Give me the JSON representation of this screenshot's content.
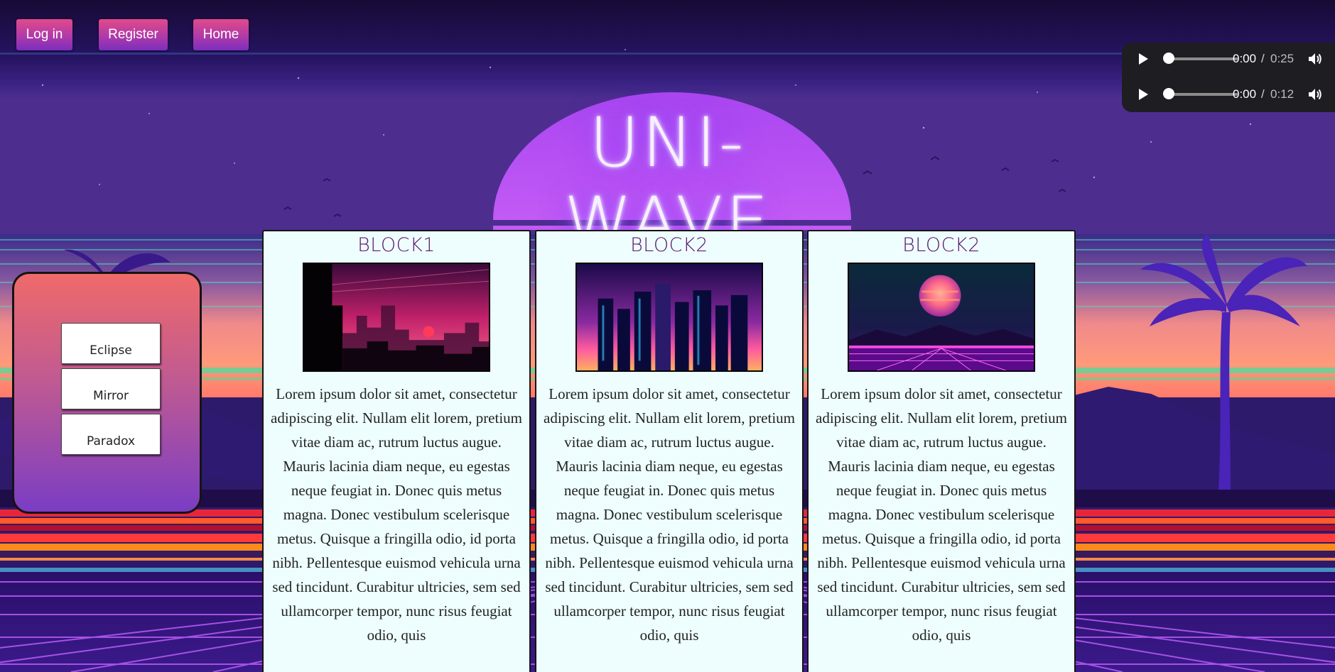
{
  "nav": {
    "login_label": "Log in",
    "register_label": "Register",
    "home_label": "Home"
  },
  "audio": [
    {
      "current": "0:00",
      "separator": "/",
      "duration": "0:25",
      "progress": 0
    },
    {
      "current": "0:00",
      "separator": "/",
      "duration": "0:12",
      "progress": 0
    }
  ],
  "site": {
    "title": "UNI-WAVE"
  },
  "sidebar": {
    "items": [
      {
        "label": "Eclipse"
      },
      {
        "label": "Mirror"
      },
      {
        "label": "Paradox"
      }
    ]
  },
  "blocks": [
    {
      "title": "BLOCK1",
      "image": "city-skyline-sunset",
      "text": "Lorem ipsum dolor sit amet, consectetur adipiscing elit. Nullam elit lorem, pretium vitae diam ac, rutrum luctus augue. Mauris lacinia diam neque, eu egestas neque feugiat in. Donec quis metus magna. Donec vestibulum scelerisque metus. Quisque a fringilla odio, id porta nibh. Pellentesque euismod vehicula urna sed tincidunt. Curabitur ultricies, sem sed ullamcorper tempor, nunc risus feugiat odio, quis"
    },
    {
      "title": "BLOCK2",
      "image": "neon-city-towers",
      "text": "Lorem ipsum dolor sit amet, consectetur adipiscing elit. Nullam elit lorem, pretium vitae diam ac, rutrum luctus augue. Mauris lacinia diam neque, eu egestas neque feugiat in. Donec quis metus magna. Donec vestibulum scelerisque metus. Quisque a fringilla odio, id porta nibh. Pellentesque euismod vehicula urna sed tincidunt. Curabitur ultricies, sem sed ullamcorper tempor, nunc risus feugiat odio, quis"
    },
    {
      "title": "BLOCK2",
      "image": "retro-planet-grid",
      "text": "Lorem ipsum dolor sit amet, consectetur adipiscing elit. Nullam elit lorem, pretium vitae diam ac, rutrum luctus augue. Mauris lacinia diam neque, eu egestas neque feugiat in. Donec quis metus magna. Donec vestibulum scelerisque metus. Quisque a fringilla odio, id porta nibh. Pellentesque euismod vehicula urna sed tincidunt. Curabitur ultricies, sem sed ullamcorper tempor, nunc risus feugiat odio, quis"
    }
  ],
  "colors": {
    "accent_pink": "#e24a8a",
    "accent_purple": "#7a2fbe",
    "block_title": "#5c176b",
    "block_bg": "#eefefe",
    "sun": "#b14cf0"
  },
  "icons": {
    "play": "play-icon",
    "volume": "volume-icon",
    "palm": "palm-tree-icon"
  }
}
